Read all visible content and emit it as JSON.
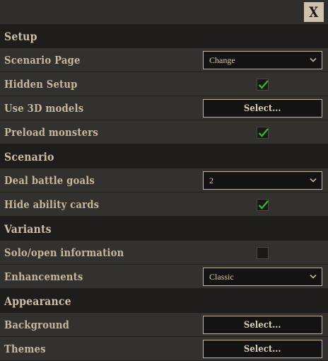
{
  "close_label": "X",
  "sections": {
    "setup": {
      "title": "Setup",
      "scenario_page": {
        "label": "Scenario Page",
        "value": "Change"
      },
      "hidden_setup": {
        "label": "Hidden Setup",
        "checked": true
      },
      "use_3d_models": {
        "label": "Use 3D models",
        "button": "Select..."
      },
      "preload_monsters": {
        "label": "Preload monsters",
        "checked": true
      }
    },
    "scenario": {
      "title": "Scenario",
      "deal_battle_goals": {
        "label": "Deal battle goals",
        "value": "2"
      },
      "hide_ability_cards": {
        "label": "Hide ability cards",
        "checked": true
      }
    },
    "variants": {
      "title": "Variants",
      "solo_open_information": {
        "label": "Solo/open information",
        "checked": false
      },
      "enhancements": {
        "label": "Enhancements",
        "value": "Classic"
      }
    },
    "appearance": {
      "title": "Appearance",
      "background": {
        "label": "Background",
        "button": "Select..."
      },
      "themes": {
        "label": "Themes",
        "button": "Select..."
      }
    }
  },
  "colors": {
    "panel": "#33312e",
    "section": "#1e1d1c",
    "label": "#c7b79d",
    "check": "#3fae2e",
    "control_border": "#c2b59c"
  },
  "icons": {
    "close": "close-icon",
    "dropdown": "chevron-down-icon",
    "check": "checkmark-icon"
  }
}
